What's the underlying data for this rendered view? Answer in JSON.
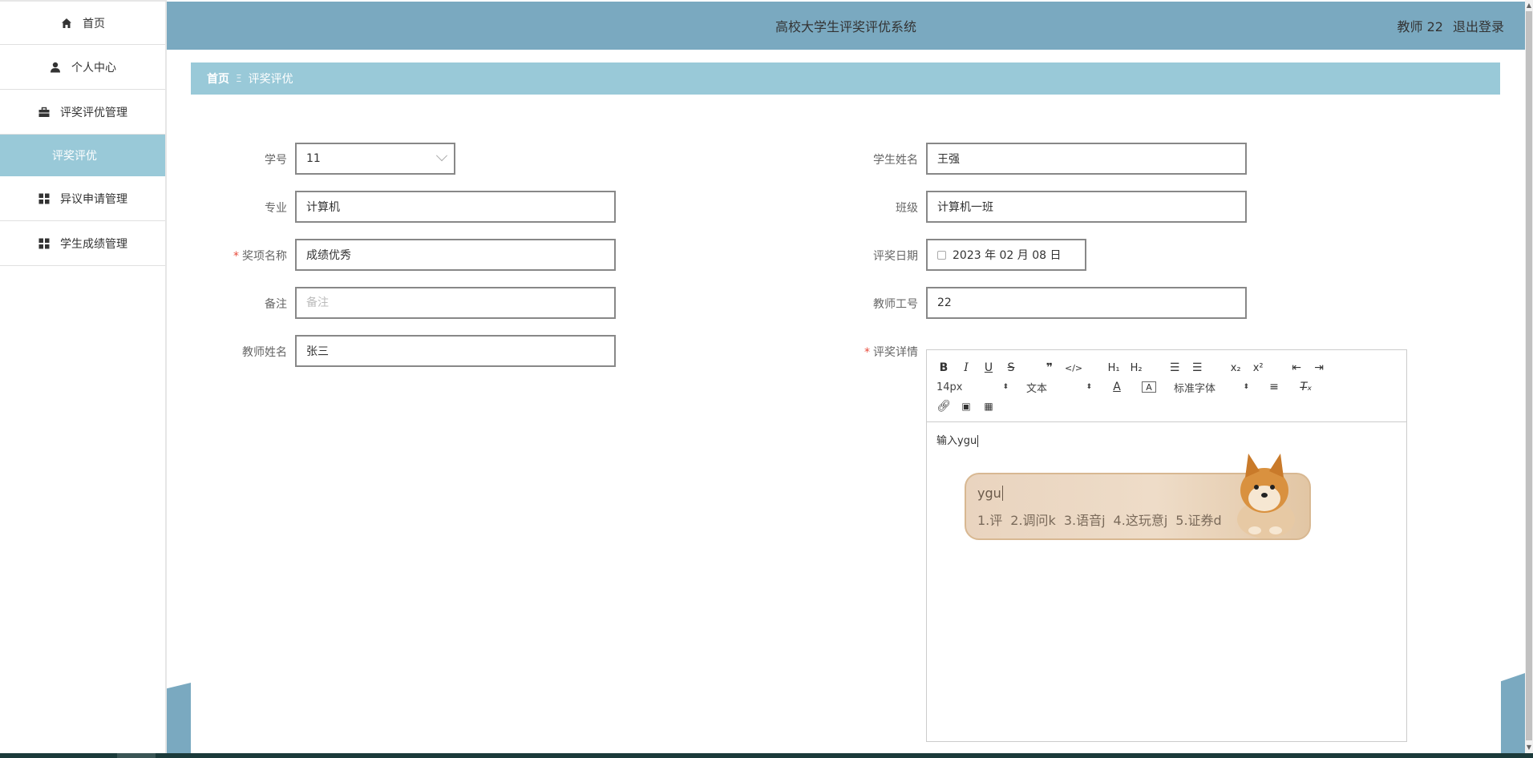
{
  "app_title": "高校大学生评奖评优系统",
  "header": {
    "user_label": "教师 22",
    "logout_label": "退出登录"
  },
  "sidebar": {
    "items": [
      {
        "label": "首页",
        "icon": "home-icon"
      },
      {
        "label": "个人中心",
        "icon": "user-icon"
      },
      {
        "label": "评奖评优管理",
        "icon": "briefcase-icon"
      },
      {
        "label": "评奖评优",
        "icon": "",
        "active": true
      },
      {
        "label": "异议申请管理",
        "icon": "grid-icon"
      },
      {
        "label": "学生成绩管理",
        "icon": "grid-icon"
      }
    ]
  },
  "breadcrumb": {
    "home": "首页",
    "separator": "Ξ",
    "current": "评奖评优"
  },
  "form": {
    "student_id": {
      "label": "学号",
      "value": "11"
    },
    "student_name": {
      "label": "学生姓名",
      "value": "王强"
    },
    "major": {
      "label": "专业",
      "value": "计算机"
    },
    "class": {
      "label": "班级",
      "value": "计算机一班"
    },
    "award_name": {
      "label": "奖项名称",
      "value": "成绩优秀"
    },
    "award_date": {
      "label": "评奖日期",
      "value": "2023 年 02 月 08 日"
    },
    "remark": {
      "label": "备注",
      "placeholder": "备注",
      "value": ""
    },
    "teacher_id": {
      "label": "教师工号",
      "value": "22"
    },
    "teacher_name": {
      "label": "教师姓名",
      "value": "张三"
    },
    "award_detail": {
      "label": "评奖详情"
    }
  },
  "editor": {
    "font_size": "14px",
    "text_type": "文本",
    "font_family": "标准字体",
    "content": "输入ygu"
  },
  "ime": {
    "input": "ygu",
    "candidates": [
      "1.评",
      "2.调问k",
      "3.语音j",
      "4.这玩意j",
      "5.证券d"
    ]
  },
  "colors": {
    "header": "#7aa9c0",
    "breadcrumb": "#99c9d8",
    "active_sidebar": "#99c9d8"
  }
}
